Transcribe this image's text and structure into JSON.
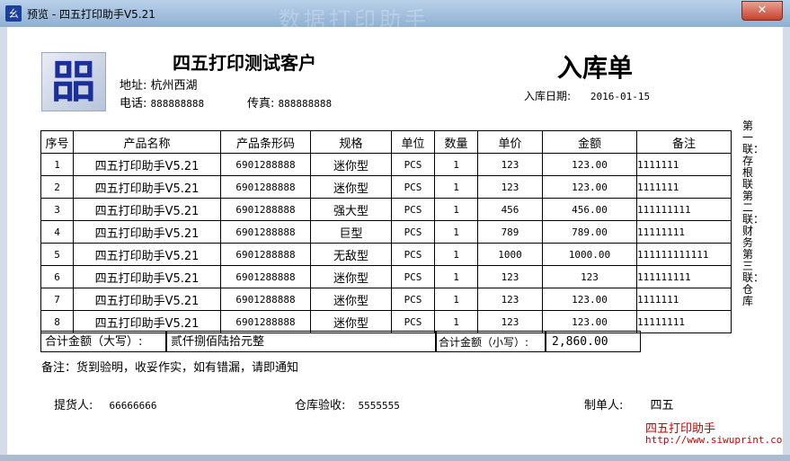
{
  "window": {
    "title": "预览 - 四五打印助手V5.21",
    "ghost_title": "数据打印助手",
    "close_label": "✕",
    "icon_glyph": "ㄠ"
  },
  "header": {
    "company": "四五打印测试客户",
    "address_label": "地址:",
    "address": "杭州西湖",
    "phone_label": "电话:",
    "phone": "888888888",
    "fax_label": "传真:",
    "fax": "888888888",
    "doc_title": "入库单",
    "date_label": "入库日期:",
    "date": "2016-01-15",
    "logo_glyph": "㗊"
  },
  "table": {
    "headers": [
      "序号",
      "产品名称",
      "产品条形码",
      "规格",
      "单位",
      "数量",
      "单价",
      "金额",
      "备注"
    ],
    "rows": [
      [
        "1",
        "四五打印助手V5.21",
        "6901288888",
        "迷你型",
        "PCS",
        "1",
        "123",
        "123.00",
        "1111111"
      ],
      [
        "2",
        "四五打印助手V5.21",
        "6901288888",
        "迷你型",
        "PCS",
        "1",
        "123",
        "123.00",
        "1111111"
      ],
      [
        "3",
        "四五打印助手V5.21",
        "6901288888",
        "强大型",
        "PCS",
        "1",
        "456",
        "456.00",
        "111111111"
      ],
      [
        "4",
        "四五打印助手V5.21",
        "6901288888",
        "巨型",
        "PCS",
        "1",
        "789",
        "789.00",
        "11111111"
      ],
      [
        "5",
        "四五打印助手V5.21",
        "6901288888",
        "无敌型",
        "PCS",
        "1",
        "1000",
        "1000.00",
        "111111111111"
      ],
      [
        "6",
        "四五打印助手V5.21",
        "6901288888",
        "迷你型",
        "PCS",
        "1",
        "123",
        "123",
        "111111111"
      ],
      [
        "7",
        "四五打印助手V5.21",
        "6901288888",
        "迷你型",
        "PCS",
        "1",
        "123",
        "123.00",
        "1111111"
      ],
      [
        "8",
        "四五打印助手V5.21",
        "6901288888",
        "迷你型",
        "PCS",
        "1",
        "123",
        "123.00",
        "11111111"
      ]
    ],
    "total_upper_label": "合计金额（大写）:",
    "total_upper": "贰仟捌佰陆拾元整",
    "total_lower_label": "合计金额（小写）:",
    "total_lower": "2,860.00"
  },
  "copies_note": "第一联：存根联 第二联：财务 第三联：仓库",
  "footer": {
    "note": "备注：货到验明，收妥作实，如有错漏，请即通知",
    "picker_label": "提货人:",
    "picker": "66666666",
    "warehouse_label": "仓库验收:",
    "warehouse": "5555555",
    "maker_label": "制单人:",
    "maker": "四五",
    "brand": "四五打印助手",
    "url": "http://www.siwuprint.co"
  }
}
